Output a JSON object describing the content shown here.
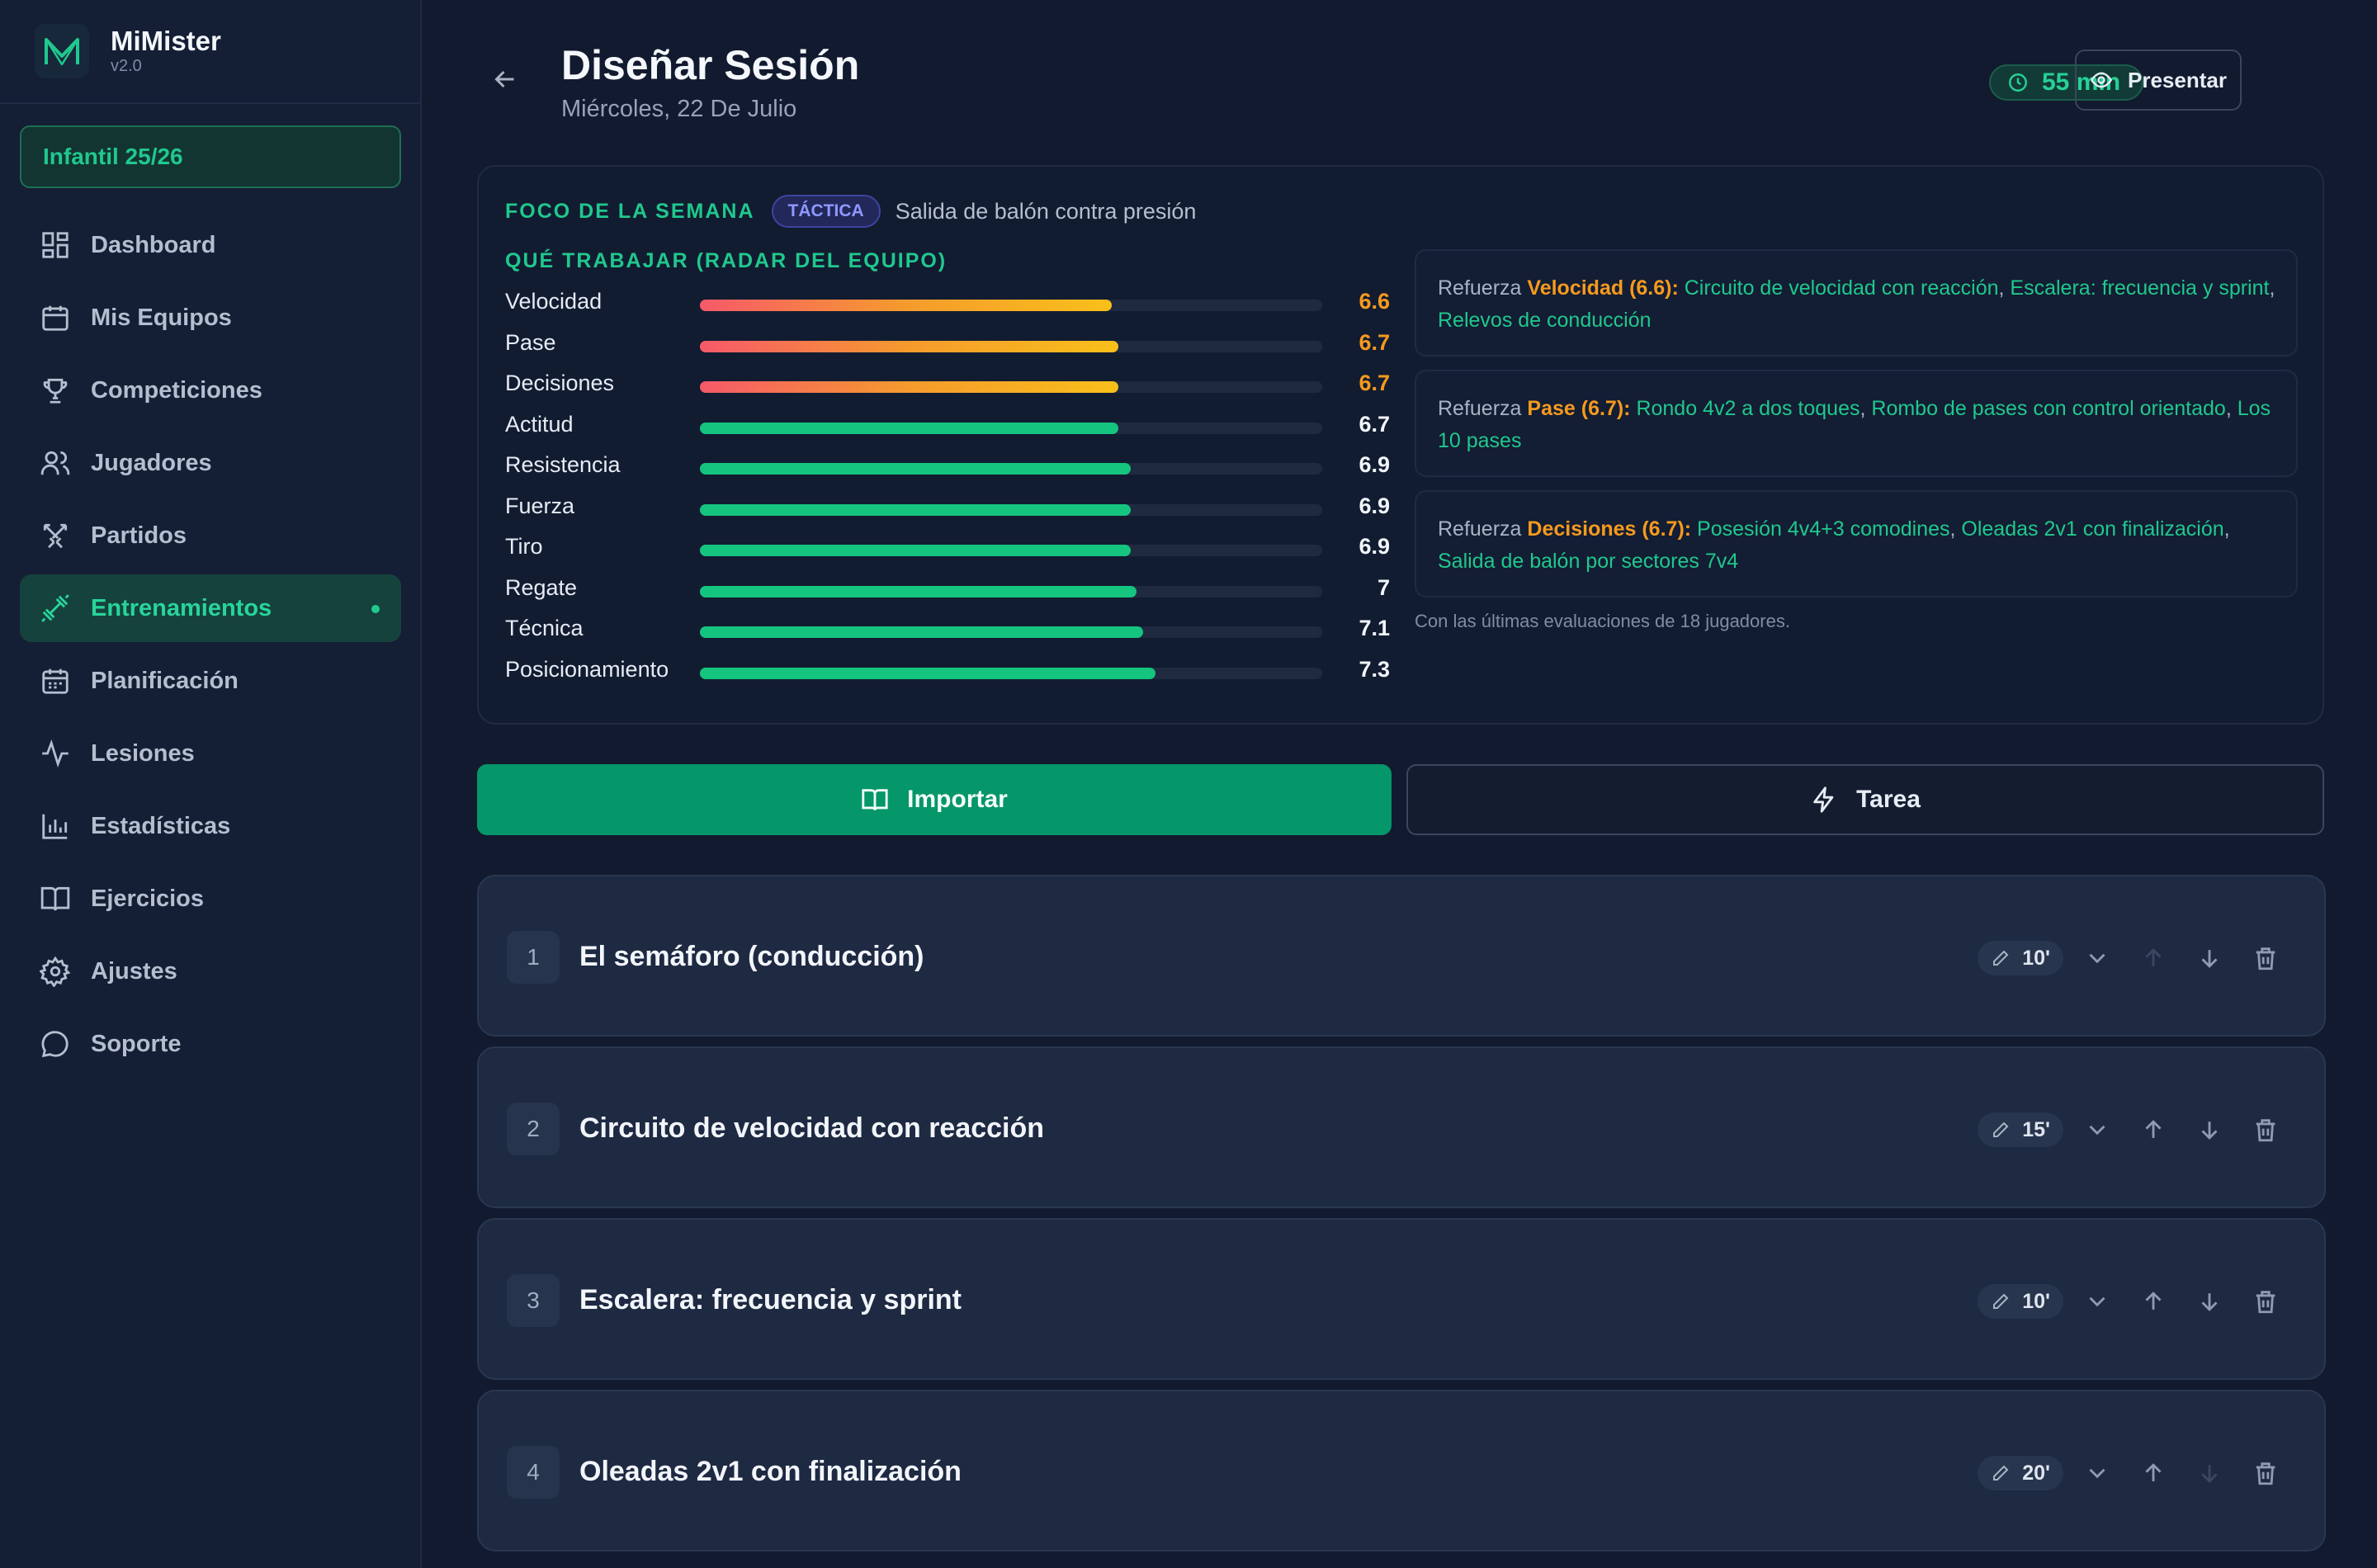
{
  "app": {
    "name": "MiMister",
    "version": "v2.0"
  },
  "team_selector": "Infantil 25/26",
  "nav": [
    {
      "label": "Dashboard",
      "icon": "dashboard-icon"
    },
    {
      "label": "Mis Equipos",
      "icon": "calendar-icon"
    },
    {
      "label": "Competiciones",
      "icon": "trophy-icon"
    },
    {
      "label": "Jugadores",
      "icon": "users-icon"
    },
    {
      "label": "Partidos",
      "icon": "swords-icon"
    },
    {
      "label": "Entrenamientos",
      "icon": "dumbbell-icon",
      "active": true
    },
    {
      "label": "Planificación",
      "icon": "calendar-days-icon"
    },
    {
      "label": "Lesiones",
      "icon": "activity-icon"
    },
    {
      "label": "Estadísticas",
      "icon": "bar-chart-icon"
    },
    {
      "label": "Ejercicios",
      "icon": "book-icon"
    },
    {
      "label": "Ajustes",
      "icon": "gear-icon"
    },
    {
      "label": "Soporte",
      "icon": "chat-icon"
    }
  ],
  "header": {
    "title": "Diseñar Sesión",
    "date": "Miércoles, 22 De Julio",
    "duration": "55 min",
    "present_label": "Presentar"
  },
  "focus": {
    "label": "FOCO DE LA SEMANA",
    "badge": "TÁCTICA",
    "text": "Salida de balón contra presión",
    "radar_label": "QUÉ TRABAJAR (RADAR DEL EQUIPO)",
    "scale_max": 10,
    "skills": [
      {
        "name": "Velocidad",
        "value": "6.6",
        "fill": 0.662,
        "level": "warn"
      },
      {
        "name": "Pase",
        "value": "6.7",
        "fill": 0.672,
        "level": "warn"
      },
      {
        "name": "Decisiones",
        "value": "6.7",
        "fill": 0.672,
        "level": "warn"
      },
      {
        "name": "Actitud",
        "value": "6.7",
        "fill": 0.672,
        "level": "good"
      },
      {
        "name": "Resistencia",
        "value": "6.9",
        "fill": 0.692,
        "level": "good"
      },
      {
        "name": "Fuerza",
        "value": "6.9",
        "fill": 0.692,
        "level": "good"
      },
      {
        "name": "Tiro",
        "value": "6.9",
        "fill": 0.692,
        "level": "good"
      },
      {
        "name": "Regate",
        "value": "7",
        "fill": 0.702,
        "level": "good"
      },
      {
        "name": "Técnica",
        "value": "7.1",
        "fill": 0.712,
        "level": "good"
      },
      {
        "name": "Posicionamiento",
        "value": "7.3",
        "fill": 0.732,
        "level": "good"
      }
    ],
    "tips": [
      {
        "prefix": "Refuerza",
        "skill": "Velocidad (6.6)",
        "exercises": [
          "Circuito de velocidad con reacción",
          "Escalera: frecuencia y sprint",
          "Relevos de conducción"
        ]
      },
      {
        "prefix": "Refuerza",
        "skill": "Pase (6.7)",
        "exercises": [
          "Rondo 4v2 a dos toques",
          "Rombo de pases con control orientado",
          "Los 10 pases"
        ]
      },
      {
        "prefix": "Refuerza",
        "skill": "Decisiones (6.7)",
        "exercises": [
          "Posesión 4v4+3 comodines",
          "Oleadas 2v1 con finalización",
          "Salida de balón por sectores 7v4"
        ]
      }
    ],
    "note": "Con las últimas evaluaciones de 18 jugadores."
  },
  "actions": {
    "import_label": "Importar",
    "task_label": "Tarea"
  },
  "sessions": [
    {
      "num": "1",
      "title": "El semáforo (conducción)",
      "minutes": "10'"
    },
    {
      "num": "2",
      "title": "Circuito de velocidad con reacción",
      "minutes": "15'"
    },
    {
      "num": "3",
      "title": "Escalera: frecuencia y sprint",
      "minutes": "10'"
    },
    {
      "num": "4",
      "title": "Oleadas 2v1 con finalización",
      "minutes": "20'"
    }
  ],
  "colors": {
    "accent": "#20c88d",
    "warning": "#f59a1e",
    "background": "#111a2e"
  }
}
